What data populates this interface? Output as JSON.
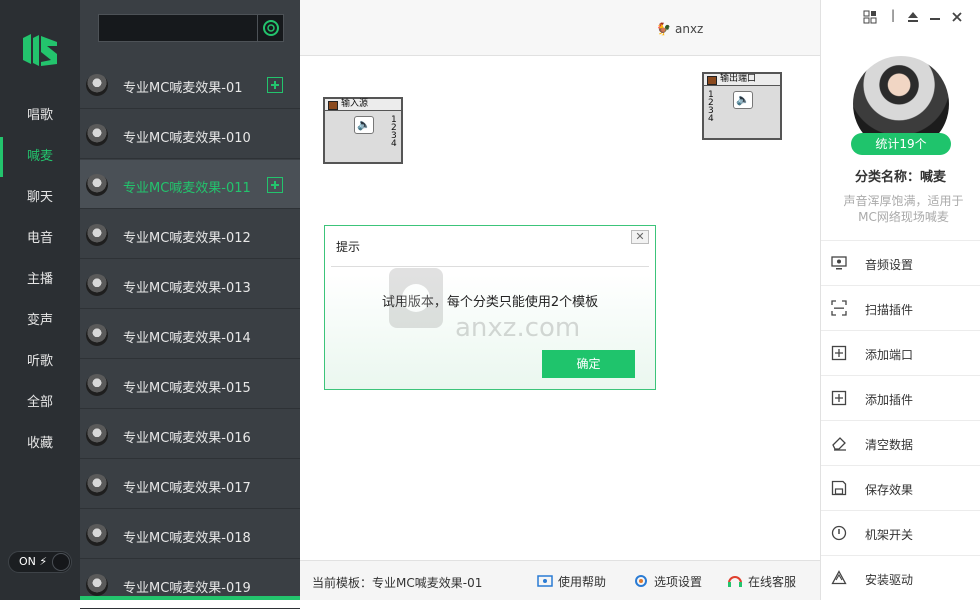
{
  "categories": [
    "唱歌",
    "喊麦",
    "聊天",
    "电音",
    "主播",
    "变声",
    "听歌",
    "全部",
    "收藏"
  ],
  "active_category_index": 1,
  "power_toggle": {
    "label": "ON ⚡",
    "state": "on"
  },
  "search": {
    "placeholder": "",
    "value": ""
  },
  "presets": [
    {
      "name": "专业MC喊麦效果-01",
      "has_add": true
    },
    {
      "name": "专业MC喊麦效果-010",
      "has_add": false
    },
    {
      "name": "专业MC喊麦效果-011",
      "has_add": true
    },
    {
      "name": "专业MC喊麦效果-012",
      "has_add": false
    },
    {
      "name": "专业MC喊麦效果-013",
      "has_add": false
    },
    {
      "name": "专业MC喊麦效果-014",
      "has_add": false
    },
    {
      "name": "专业MC喊麦效果-015",
      "has_add": false
    },
    {
      "name": "专业MC喊麦效果-016",
      "has_add": false
    },
    {
      "name": "专业MC喊麦效果-017",
      "has_add": false
    },
    {
      "name": "专业MC喊麦效果-018",
      "has_add": false
    },
    {
      "name": "专业MC喊麦效果-019",
      "has_add": false
    }
  ],
  "active_preset_index": 2,
  "header": {
    "username": "anxz"
  },
  "nodes": {
    "input": {
      "title": "输入源",
      "ports": [
        "1",
        "2",
        "3",
        "4"
      ]
    },
    "output": {
      "title": "输出端口",
      "ports": [
        "1",
        "2",
        "3",
        "4"
      ]
    }
  },
  "dialog": {
    "title": "提示",
    "close": "✕",
    "message": "试用版本，每个分类只能使用2个模板",
    "ok_label": "确定"
  },
  "watermark": {
    "text": "anxz.com"
  },
  "footer": {
    "current_template": "当前模板：专业MC喊麦效果-01",
    "help": "使用帮助",
    "options": "选项设置",
    "support": "在线客服"
  },
  "right_panel": {
    "stat": "统计19个",
    "category_name": "分类名称：喊麦",
    "description": "声音浑厚饱满，适用于MC网络现场喊麦",
    "menu": [
      {
        "label": "音频设置",
        "icon": "monitor-icon"
      },
      {
        "label": "扫描插件",
        "icon": "scan-icon"
      },
      {
        "label": "添加端口",
        "icon": "add-port-icon"
      },
      {
        "label": "添加插件",
        "icon": "add-plugin-icon"
      },
      {
        "label": "清空数据",
        "icon": "eraser-icon"
      },
      {
        "label": "保存效果",
        "icon": "save-icon"
      },
      {
        "label": "机架开关",
        "icon": "power-icon"
      },
      {
        "label": "安装驱动",
        "icon": "drive-icon"
      }
    ]
  },
  "colors": {
    "accent": "#1fc46c",
    "sidebar": "#2b2f33",
    "list": "#3a3f44"
  }
}
